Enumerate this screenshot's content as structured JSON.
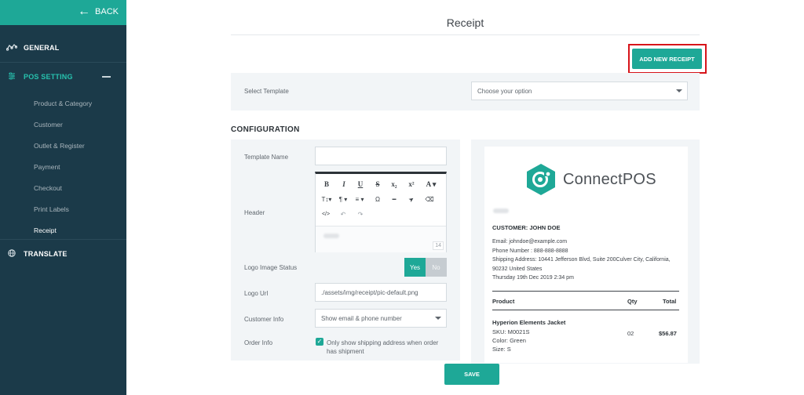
{
  "sidebar": {
    "back_label": "BACK",
    "general": {
      "label": "GENERAL",
      "icon": "analytics-icon"
    },
    "pos_setting": {
      "label": "POS SETTING",
      "icon": "sliders-icon",
      "items": [
        {
          "label": "Product & Category"
        },
        {
          "label": "Customer"
        },
        {
          "label": "Outlet & Register"
        },
        {
          "label": "Payment"
        },
        {
          "label": "Checkout"
        },
        {
          "label": "Print Labels"
        },
        {
          "label": "Receipt"
        }
      ]
    },
    "translate": {
      "label": "TRANSLATE",
      "icon": "globe-icon"
    }
  },
  "page": {
    "title": "Receipt",
    "add_button": "ADD NEW RECEIPT",
    "select_template": {
      "label": "Select Template",
      "value": "Choose your option"
    },
    "configuration_title": "CONFIGURATION",
    "save_button": "SAVE"
  },
  "config": {
    "template_name": {
      "label": "Template Name",
      "value": ""
    },
    "header": {
      "label": "Header",
      "counter": "14"
    },
    "toolbar": {
      "row1": [
        "B",
        "I",
        "U",
        "S",
        "x₂",
        "x²",
        "A ▾"
      ],
      "row2": [
        "T↕▾",
        "¶ ▾",
        "≡ ▾",
        "Ω",
        "━",
        "➤",
        "⌫"
      ],
      "row3": [
        "</>",
        "↶",
        "↷"
      ]
    },
    "logo_status": {
      "label": "Logo Image Status",
      "yes": "Yes",
      "no": "No"
    },
    "logo_url": {
      "label": "Logo Url",
      "value": "./assets/img/receipt/pic-default.png"
    },
    "customer_info": {
      "label": "Customer Info",
      "value": "Show email & phone number"
    },
    "order_info": {
      "label": "Order Info",
      "checkbox_text": "Only show shipping address when order has shipment"
    }
  },
  "receipt": {
    "brand": "ConnectPOS",
    "customer_heading": "CUSTOMER: JOHN DOE",
    "email": "Email: johndoe@example.com",
    "phone": "Phone Number : 888-888-8888",
    "shipping": "Shipping Address: 10441 Jefferson Blvd, Suite 200Culver City, California, 90232 United States",
    "date": "Thursday 19th Dec 2019 2:34 pm",
    "columns": {
      "product": "Product",
      "qty": "Qty",
      "total": "Total"
    },
    "item": {
      "name": "Hyperion Elements Jacket",
      "sku": "SKU: M0021S",
      "color": "Color: Green",
      "size": "Size: S",
      "qty": "02",
      "total": "$56.87"
    }
  },
  "colors": {
    "accent": "#1ea897",
    "sidebar": "#1b3a49",
    "highlight": "#d7141a"
  }
}
